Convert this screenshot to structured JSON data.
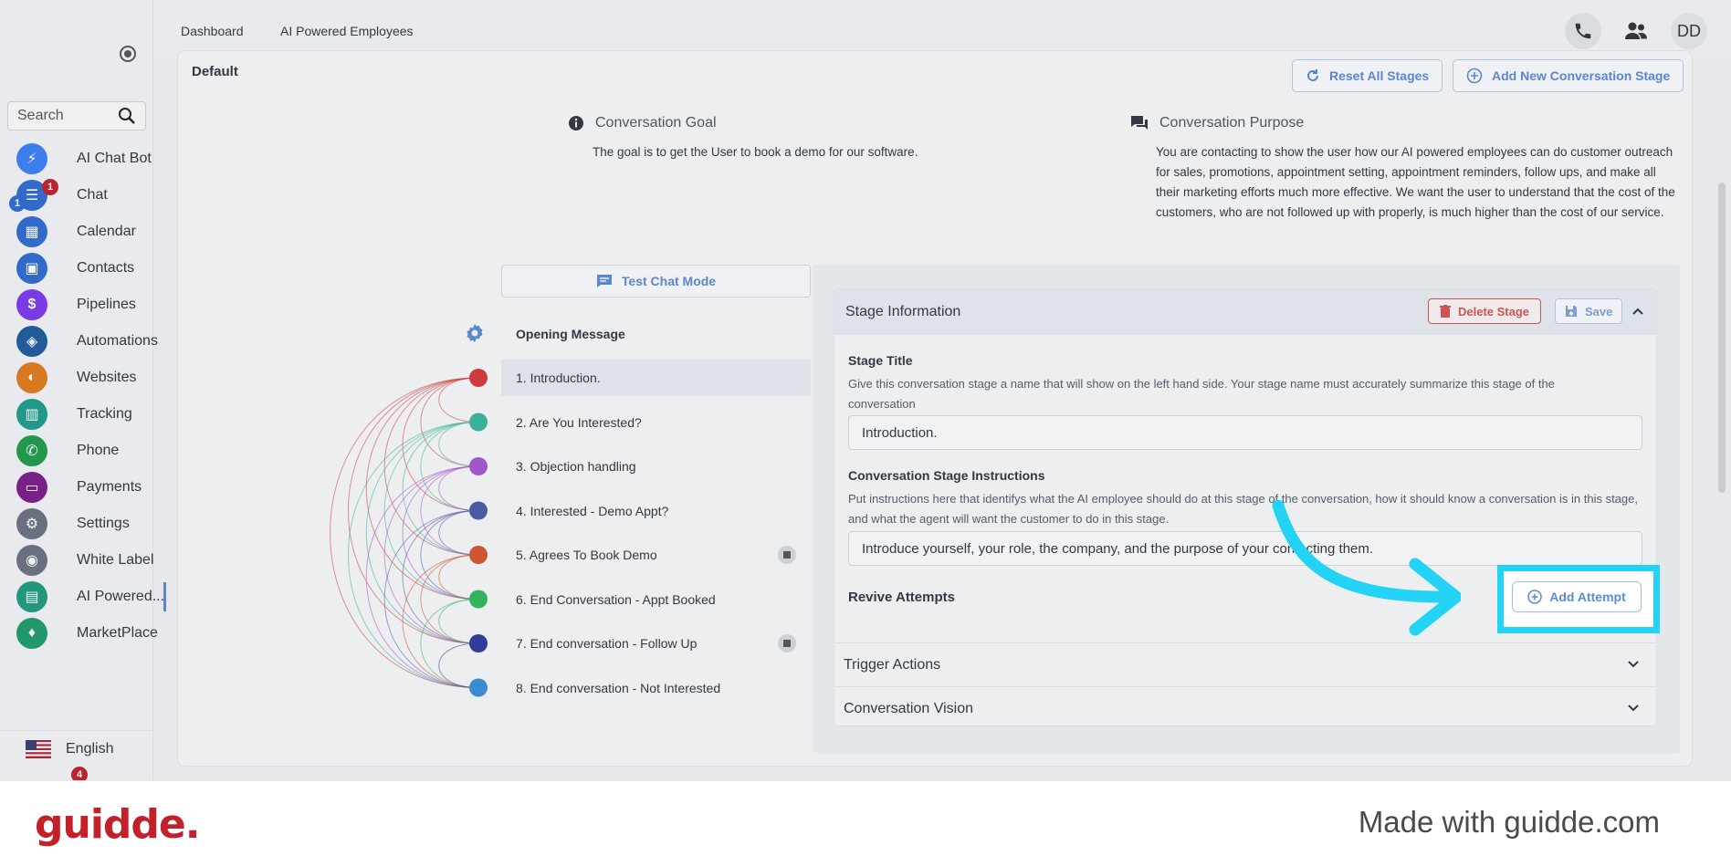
{
  "sidebar": {
    "search_placeholder": "Search",
    "items": [
      {
        "label": "AI Chat Bot",
        "icon": "bolt-icon",
        "color": "#3b82f6"
      },
      {
        "label": "Chat",
        "icon": "chat-icon",
        "color": "#2f6bd1",
        "badges": [
          "1",
          "1"
        ]
      },
      {
        "label": "Calendar",
        "icon": "calendar-icon",
        "color": "#2f6bd1"
      },
      {
        "label": "Contacts",
        "icon": "contacts-icon",
        "color": "#2f6bd1"
      },
      {
        "label": "Pipelines",
        "icon": "dollar-icon",
        "color": "#7c3aed"
      },
      {
        "label": "Automations",
        "icon": "automation-icon",
        "color": "#1e5b9c"
      },
      {
        "label": "Websites",
        "icon": "websites-icon",
        "color": "#e07b1a"
      },
      {
        "label": "Tracking",
        "icon": "chart-icon",
        "color": "#1e9c8c"
      },
      {
        "label": "Phone",
        "icon": "phone-icon",
        "color": "#1e9c4c"
      },
      {
        "label": "Payments",
        "icon": "card-icon",
        "color": "#7c1a8c"
      },
      {
        "label": "Settings",
        "icon": "gear-icon",
        "color": "#6b7280"
      },
      {
        "label": "White Label",
        "icon": "palette-icon",
        "color": "#6b7280"
      },
      {
        "label": "AI Powered...",
        "icon": "ai-chat-icon",
        "color": "#1e9c7c"
      },
      {
        "label": "MarketPlace",
        "icon": "marketplace-icon",
        "color": "#1e9c6c"
      }
    ],
    "language": "English",
    "bottom_badge": "4"
  },
  "topbar": {
    "tabs": [
      "Dashboard",
      "AI Powered Employees"
    ],
    "avatar": "DD"
  },
  "main": {
    "section_label": "Default",
    "reset_button": "Reset All Stages",
    "add_stage_button": "Add New Conversation Stage",
    "goal_title": "Conversation Goal",
    "goal_text": "The goal is to get the User to book a demo for our software.",
    "purpose_title": "Conversation Purpose",
    "purpose_text": "You are contacting to show the user how our AI powered employees can do customer outreach for sales, promotions, appointment setting, appointment reminders, follow ups, and make all their marketing efforts much more effective. We want the user to understand that the cost of the customers, who are not followed up with properly, is much higher than the cost of our service.",
    "test_chat_button": "Test Chat Mode",
    "opening_message": "Opening Message",
    "stages": [
      {
        "label": "1. Introduction.",
        "color": "#d63a3a"
      },
      {
        "label": "2. Are You Interested?",
        "color": "#3ab79c"
      },
      {
        "label": "3. Objection handling",
        "color": "#a855d6"
      },
      {
        "label": "4. Interested - Demo Appt?",
        "color": "#4a5ba8"
      },
      {
        "label": "5. Agrees To Book Demo",
        "color": "#d6552a"
      },
      {
        "label": "6. End Conversation - Appt Booked",
        "color": "#2fb85a"
      },
      {
        "label": "7. End conversation - Follow Up",
        "color": "#2f3a9c"
      },
      {
        "label": "8. End conversation - Not Interested",
        "color": "#3a8ed6"
      }
    ]
  },
  "panel": {
    "header": "Stage Information",
    "delete_button": "Delete Stage",
    "save_button": "Save",
    "stage_title_label": "Stage Title",
    "stage_title_help": "Give this conversation stage a name that will show on the left hand side. Your stage name must accurately summarize this stage of the conversation",
    "stage_title_value": "Introduction.",
    "instructions_label": "Conversation Stage Instructions",
    "instructions_help": "Put instructions here that identifys what the AI employee should do at this stage of the conversation, how it should know a conversation is in this stage, and what the agent will want the customer to do in this stage.",
    "instructions_value": "Introduce yourself, your role, the company, and the purpose of your contacting them.",
    "revive_label": "Revive Attempts",
    "add_attempt_button": "Add Attempt",
    "trigger_actions": "Trigger Actions",
    "conversation_vision": "Conversation Vision"
  },
  "footer": {
    "brand": "guidde.",
    "made_with": "Made with guidde.com"
  }
}
